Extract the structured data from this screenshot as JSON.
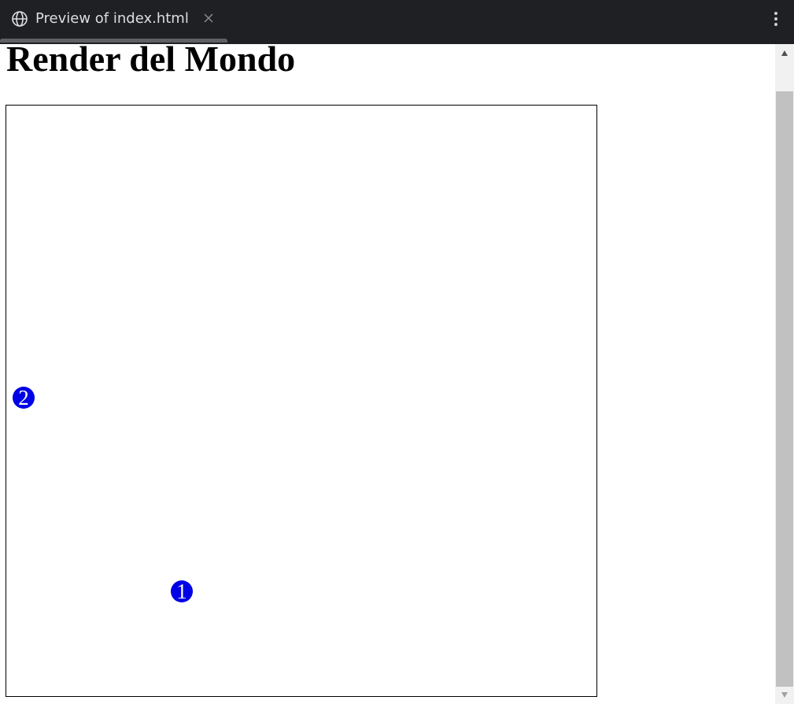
{
  "tab": {
    "title": "Preview of index.html",
    "icon": "globe-icon",
    "close_icon": "close-icon"
  },
  "toolbar": {
    "menu_icon": "more-vertical-icon"
  },
  "page": {
    "title": "Render del Mondo"
  },
  "world": {
    "entities": [
      {
        "label": "1"
      },
      {
        "label": "2"
      }
    ],
    "entity_color": "#0000e6"
  },
  "colors": {
    "tabbar": "#1f2023",
    "tab_text": "#dcdde0",
    "scroll_thumb": "#c1c1c1"
  }
}
